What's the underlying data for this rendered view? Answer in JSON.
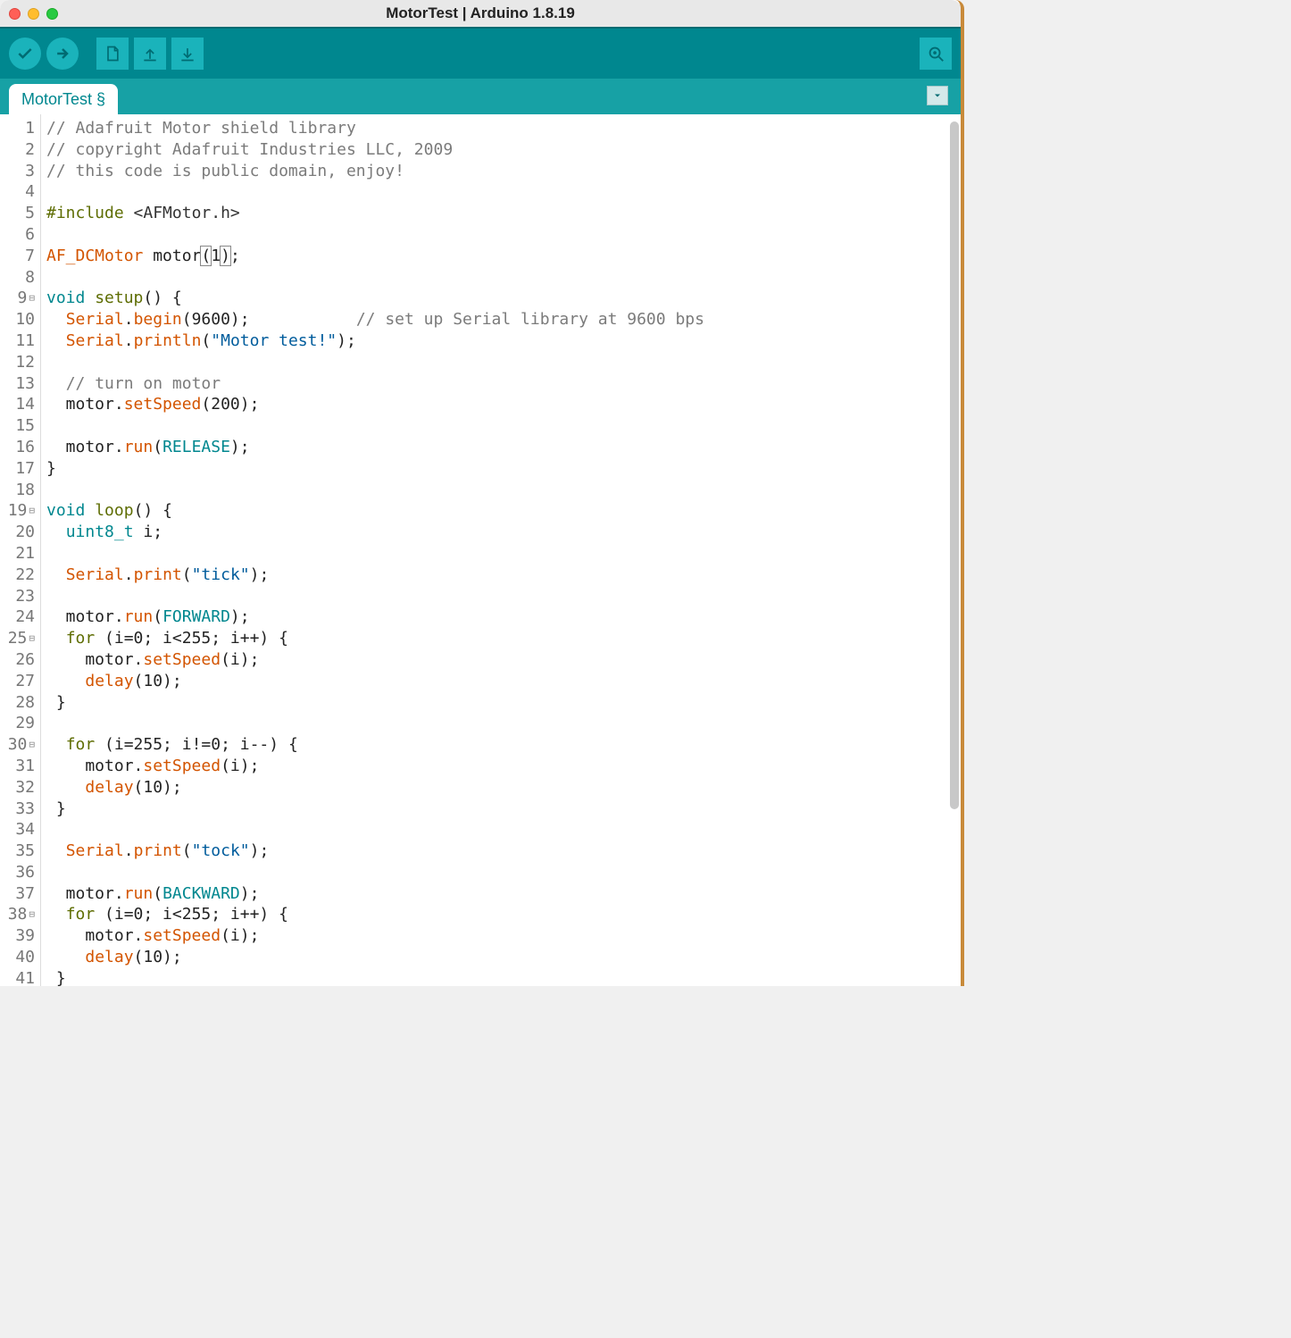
{
  "window": {
    "title": "MotorTest | Arduino 1.8.19"
  },
  "tab": {
    "label": "MotorTest §"
  },
  "toolbar": {
    "verify": "Verify",
    "upload": "Upload",
    "new": "New",
    "open": "Open",
    "save": "Save",
    "serial": "Serial Monitor"
  },
  "fold_lines": [
    9,
    19,
    25,
    30,
    38
  ],
  "code_lines": [
    {
      "n": 1,
      "tokens": [
        {
          "t": "// Adafruit Motor shield library",
          "c": "c-comment"
        }
      ]
    },
    {
      "n": 2,
      "tokens": [
        {
          "t": "// copyright Adafruit Industries LLC, 2009",
          "c": "c-comment"
        }
      ]
    },
    {
      "n": 3,
      "tokens": [
        {
          "t": "// this code is public domain, enjoy!",
          "c": "c-comment"
        }
      ]
    },
    {
      "n": 4,
      "tokens": []
    },
    {
      "n": 5,
      "tokens": [
        {
          "t": "#include",
          "c": "c-preproc"
        },
        {
          "t": " "
        },
        {
          "t": "<AFMotor.h>",
          "c": "c-preproc-name"
        }
      ]
    },
    {
      "n": 6,
      "tokens": []
    },
    {
      "n": 7,
      "tokens": [
        {
          "t": "AF_DCMotor",
          "c": "c-type"
        },
        {
          "t": " motor"
        },
        {
          "t": "(",
          "c": "c-bracket-hl"
        },
        {
          "t": "1"
        },
        {
          "t": ")",
          "c": "c-bracket-hl"
        },
        {
          "t": ";"
        }
      ]
    },
    {
      "n": 8,
      "tokens": []
    },
    {
      "n": 9,
      "tokens": [
        {
          "t": "void",
          "c": "c-keyword"
        },
        {
          "t": " "
        },
        {
          "t": "setup",
          "c": "c-preproc"
        },
        {
          "t": "() {"
        }
      ]
    },
    {
      "n": 10,
      "tokens": [
        {
          "t": "  "
        },
        {
          "t": "Serial",
          "c": "c-type"
        },
        {
          "t": "."
        },
        {
          "t": "begin",
          "c": "c-func"
        },
        {
          "t": "(9600);           "
        },
        {
          "t": "// set up Serial library at 9600 bps",
          "c": "c-comment"
        }
      ]
    },
    {
      "n": 11,
      "tokens": [
        {
          "t": "  "
        },
        {
          "t": "Serial",
          "c": "c-type"
        },
        {
          "t": "."
        },
        {
          "t": "println",
          "c": "c-func"
        },
        {
          "t": "("
        },
        {
          "t": "\"Motor test!\"",
          "c": "c-str"
        },
        {
          "t": ");"
        }
      ]
    },
    {
      "n": 12,
      "tokens": []
    },
    {
      "n": 13,
      "tokens": [
        {
          "t": "  "
        },
        {
          "t": "// turn on motor",
          "c": "c-comment"
        }
      ]
    },
    {
      "n": 14,
      "tokens": [
        {
          "t": "  motor."
        },
        {
          "t": "setSpeed",
          "c": "c-func"
        },
        {
          "t": "(200);"
        }
      ]
    },
    {
      "n": 15,
      "tokens": []
    },
    {
      "n": 16,
      "tokens": [
        {
          "t": "  motor."
        },
        {
          "t": "run",
          "c": "c-func"
        },
        {
          "t": "("
        },
        {
          "t": "RELEASE",
          "c": "c-type2"
        },
        {
          "t": ");"
        }
      ]
    },
    {
      "n": 17,
      "tokens": [
        {
          "t": "}"
        }
      ]
    },
    {
      "n": 18,
      "tokens": []
    },
    {
      "n": 19,
      "tokens": [
        {
          "t": "void",
          "c": "c-keyword"
        },
        {
          "t": " "
        },
        {
          "t": "loop",
          "c": "c-preproc"
        },
        {
          "t": "() {"
        }
      ]
    },
    {
      "n": 20,
      "tokens": [
        {
          "t": "  "
        },
        {
          "t": "uint8_t",
          "c": "c-keyword"
        },
        {
          "t": " i;"
        }
      ]
    },
    {
      "n": 21,
      "tokens": []
    },
    {
      "n": 22,
      "tokens": [
        {
          "t": "  "
        },
        {
          "t": "Serial",
          "c": "c-type"
        },
        {
          "t": "."
        },
        {
          "t": "print",
          "c": "c-func"
        },
        {
          "t": "("
        },
        {
          "t": "\"tick\"",
          "c": "c-str"
        },
        {
          "t": ");"
        }
      ]
    },
    {
      "n": 23,
      "tokens": []
    },
    {
      "n": 24,
      "tokens": [
        {
          "t": "  motor."
        },
        {
          "t": "run",
          "c": "c-func"
        },
        {
          "t": "("
        },
        {
          "t": "FORWARD",
          "c": "c-type2"
        },
        {
          "t": ");"
        }
      ]
    },
    {
      "n": 25,
      "tokens": [
        {
          "t": "  "
        },
        {
          "t": "for",
          "c": "c-preproc"
        },
        {
          "t": " (i=0; i<255; i++) {"
        }
      ]
    },
    {
      "n": 26,
      "tokens": [
        {
          "t": "    motor."
        },
        {
          "t": "setSpeed",
          "c": "c-func"
        },
        {
          "t": "(i);"
        }
      ]
    },
    {
      "n": 27,
      "tokens": [
        {
          "t": "    "
        },
        {
          "t": "delay",
          "c": "c-func"
        },
        {
          "t": "(10);"
        }
      ]
    },
    {
      "n": 28,
      "tokens": [
        {
          "t": " }"
        }
      ]
    },
    {
      "n": 29,
      "tokens": []
    },
    {
      "n": 30,
      "tokens": [
        {
          "t": "  "
        },
        {
          "t": "for",
          "c": "c-preproc"
        },
        {
          "t": " (i=255; i!=0; i--) {"
        }
      ]
    },
    {
      "n": 31,
      "tokens": [
        {
          "t": "    motor."
        },
        {
          "t": "setSpeed",
          "c": "c-func"
        },
        {
          "t": "(i);"
        }
      ]
    },
    {
      "n": 32,
      "tokens": [
        {
          "t": "    "
        },
        {
          "t": "delay",
          "c": "c-func"
        },
        {
          "t": "(10);"
        }
      ]
    },
    {
      "n": 33,
      "tokens": [
        {
          "t": " }"
        }
      ]
    },
    {
      "n": 34,
      "tokens": []
    },
    {
      "n": 35,
      "tokens": [
        {
          "t": "  "
        },
        {
          "t": "Serial",
          "c": "c-type"
        },
        {
          "t": "."
        },
        {
          "t": "print",
          "c": "c-func"
        },
        {
          "t": "("
        },
        {
          "t": "\"tock\"",
          "c": "c-str"
        },
        {
          "t": ");"
        }
      ]
    },
    {
      "n": 36,
      "tokens": []
    },
    {
      "n": 37,
      "tokens": [
        {
          "t": "  motor."
        },
        {
          "t": "run",
          "c": "c-func"
        },
        {
          "t": "("
        },
        {
          "t": "BACKWARD",
          "c": "c-type2"
        },
        {
          "t": ");"
        }
      ]
    },
    {
      "n": 38,
      "tokens": [
        {
          "t": "  "
        },
        {
          "t": "for",
          "c": "c-preproc"
        },
        {
          "t": " (i=0; i<255; i++) {"
        }
      ]
    },
    {
      "n": 39,
      "tokens": [
        {
          "t": "    motor."
        },
        {
          "t": "setSpeed",
          "c": "c-func"
        },
        {
          "t": "(i);"
        }
      ]
    },
    {
      "n": 40,
      "tokens": [
        {
          "t": "    "
        },
        {
          "t": "delay",
          "c": "c-func"
        },
        {
          "t": "(10);"
        }
      ]
    },
    {
      "n": 41,
      "tokens": [
        {
          "t": " }"
        }
      ]
    }
  ]
}
